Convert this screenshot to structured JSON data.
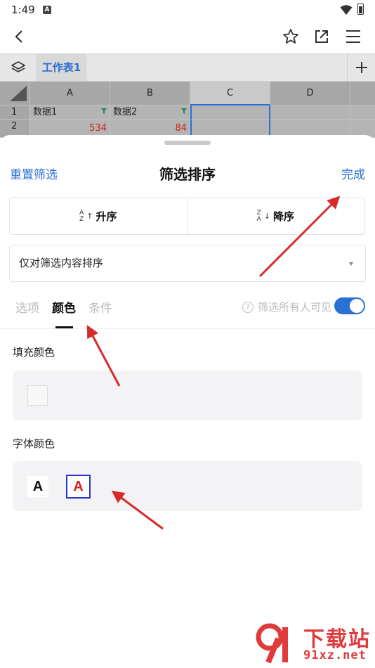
{
  "status_bar": {
    "time": "1:49",
    "notification_glyph": "A"
  },
  "toolbar": {
    "back_icon": "back-arrow-icon",
    "star_icon": "star-icon",
    "share_icon": "share-external-icon",
    "menu_icon": "hamburger-menu-icon"
  },
  "sheet_tabs": {
    "active_tab": "工作表1",
    "add_icon": "plus-icon",
    "layers_icon": "layers-icon"
  },
  "grid": {
    "columns": [
      "A",
      "B",
      "C",
      "D"
    ],
    "rows": [
      {
        "num": "1",
        "cells": [
          "数据1",
          "数据2",
          "",
          ""
        ]
      },
      {
        "num": "2",
        "cells": [
          "534",
          "84",
          "",
          ""
        ]
      }
    ]
  },
  "filter_sheet": {
    "reset_label": "重置筛选",
    "title": "筛选排序",
    "done_label": "完成",
    "sort_asc_label": "升序",
    "sort_asc_glyph_top": "A",
    "sort_asc_glyph_bottom": "Z",
    "sort_desc_label": "降序",
    "sort_desc_glyph_top": "Z",
    "sort_desc_glyph_bottom": "A",
    "dropdown_value": "仅对筛选内容排序",
    "tabs": [
      "选项",
      "颜色",
      "条件"
    ],
    "active_tab_index": 1,
    "visibility_label": "筛选所有人可见",
    "help_glyph": "?",
    "visibility_toggle_on": true,
    "fill_color_label": "填充颜色",
    "font_color_label": "字体颜色",
    "font_swatch_glyph": "A"
  },
  "colors": {
    "accent": "#2a6fd4",
    "red_font": "#d92020",
    "arrow": "#d62b2b"
  },
  "watermark": {
    "line1": "下载站",
    "line2": "91xz.net"
  }
}
